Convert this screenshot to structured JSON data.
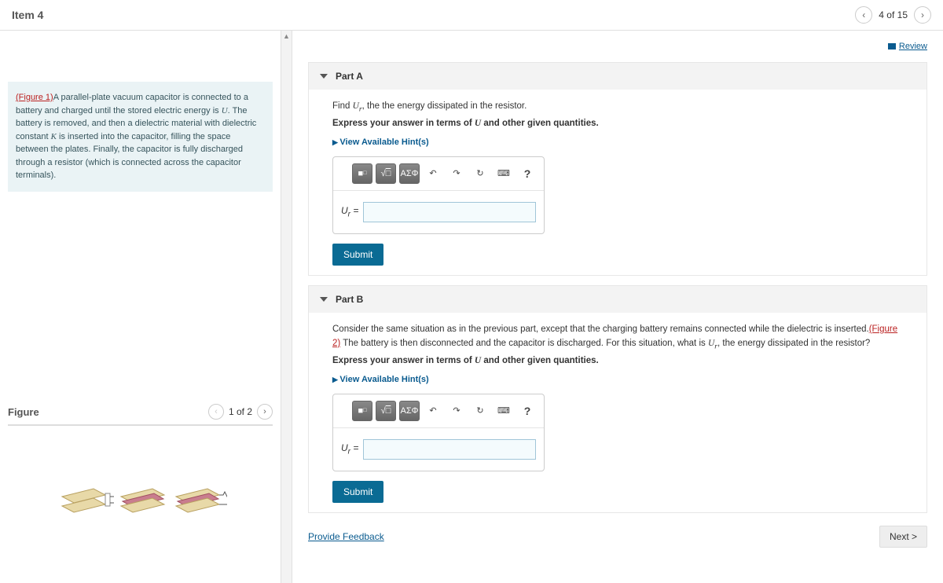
{
  "header": {
    "title": "Item 4",
    "position": "4 of 15"
  },
  "review": "Review",
  "problem": {
    "fig_link": "(Figure 1)",
    "t1": "A parallel-plate vacuum capacitor is connected to a battery and charged until the stored electric energy is ",
    "u": "U",
    "t2": ". The battery is removed, and then a dielectric material with dielectric constant ",
    "k": "K",
    "t3": " is inserted into the capacitor, filling the space between the plates. Finally, the capacitor is fully discharged through a resistor (which is connected across the capacitor terminals)."
  },
  "figure": {
    "heading": "Figure",
    "position": "1 of 2"
  },
  "partA": {
    "title": "Part A",
    "p1a": "Find ",
    "ur": "U",
    "ur_sub": "r",
    "p1b": ", the the energy dissipated in the resistor.",
    "instr_a": "Express your answer in terms of ",
    "instr_b": " and other given quantities.",
    "instr_u": "U",
    "hints": "View Available Hint(s)",
    "greek": "ΑΣΦ",
    "label": "U",
    "label_sub": "r",
    "eq": " = ",
    "submit": "Submit"
  },
  "partB": {
    "title": "Part B",
    "p1a": "Consider the same situation as in the previous part, except that the charging battery remains connected while the dielectric is inserted.",
    "fig_link": "(Figure 2)",
    "p1b": " The battery is then disconnected and the capacitor is discharged. For this situation, what is ",
    "ur": "U",
    "ur_sub": "r",
    "p1c": ", the energy dissipated in the resistor?",
    "instr_a": "Express your answer in terms of ",
    "instr_b": " and other given quantities.",
    "instr_u": "U",
    "hints": "View Available Hint(s)",
    "greek": "ΑΣΦ",
    "label": "U",
    "label_sub": "r",
    "eq": " = ",
    "submit": "Submit"
  },
  "footer": {
    "feedback": "Provide Feedback",
    "next": "Next >"
  },
  "icons": {
    "undo": "↶",
    "redo": "↷",
    "reset": "↻",
    "help": "?",
    "kb": "⌨",
    "sqrt": "√"
  }
}
